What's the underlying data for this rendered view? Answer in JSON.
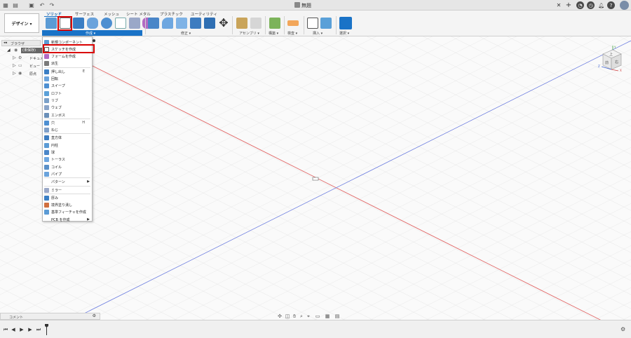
{
  "window": {
    "title": "無題"
  },
  "workspace": {
    "label": "デザイン ▾"
  },
  "tabs": [
    {
      "label": "ソリッド",
      "active": true
    },
    {
      "label": "サーフェス"
    },
    {
      "label": "メッシュ"
    },
    {
      "label": "シート メタル"
    },
    {
      "label": "プラスチック"
    },
    {
      "label": "ユーティリティ"
    }
  ],
  "tool_groups": {
    "create": "作成 ▾",
    "modify": "修正 ▾",
    "assemble": "アセンブリ ▾",
    "construct": "構築 ▾",
    "inspect": "検査 ▾",
    "insert": "挿入 ▾",
    "select": "選択 ▾"
  },
  "browser": {
    "title": "ブラウザ",
    "rows": [
      {
        "label": "(未保存)"
      },
      {
        "label": "ドキュメントの設定"
      },
      {
        "label": "ビュー"
      },
      {
        "label": "原点"
      }
    ]
  },
  "create_menu": {
    "items": [
      {
        "label": "新規コンポーネント",
        "icon": "new-component-icon",
        "key": ""
      },
      {
        "label": "スケッチを作成",
        "icon": "create-sketch-icon",
        "key": "",
        "highlighted": true
      },
      {
        "label": "フォームを作成",
        "icon": "create-form-icon",
        "key": ""
      },
      {
        "label": "派生",
        "icon": "derive-icon",
        "key": ""
      },
      {
        "label": "押し出し",
        "icon": "extrude-icon",
        "key": "E"
      },
      {
        "label": "回転",
        "icon": "revolve-icon",
        "key": ""
      },
      {
        "label": "スイープ",
        "icon": "sweep-icon",
        "key": ""
      },
      {
        "label": "ロフト",
        "icon": "loft-icon",
        "key": ""
      },
      {
        "label": "リブ",
        "icon": "rib-icon",
        "key": ""
      },
      {
        "label": "ウェブ",
        "icon": "web-icon",
        "key": ""
      },
      {
        "label": "エンボス",
        "icon": "emboss-icon",
        "key": ""
      },
      {
        "label": "穴",
        "icon": "hole-icon",
        "key": "H"
      },
      {
        "label": "ねじ",
        "icon": "thread-icon",
        "key": ""
      },
      {
        "label": "直方体",
        "icon": "box-icon",
        "key": ""
      },
      {
        "label": "円柱",
        "icon": "cylinder-icon",
        "key": ""
      },
      {
        "label": "球",
        "icon": "sphere-icon",
        "key": ""
      },
      {
        "label": "トーラス",
        "icon": "torus-icon",
        "key": ""
      },
      {
        "label": "コイル",
        "icon": "coil-icon",
        "key": ""
      },
      {
        "label": "パイプ",
        "icon": "pipe-icon",
        "key": ""
      },
      {
        "label": "パターン",
        "icon": "",
        "key": "",
        "submenu": true
      },
      {
        "label": "ミラー",
        "icon": "mirror-icon",
        "key": ""
      },
      {
        "label": "厚み",
        "icon": "thicken-icon",
        "key": ""
      },
      {
        "label": "境界塗り潰し",
        "icon": "boundary-fill-icon",
        "key": ""
      },
      {
        "label": "基準フィーチャを作成",
        "icon": "base-feature-icon",
        "key": ""
      },
      {
        "label": "PCB を作成",
        "icon": "",
        "key": "",
        "submenu": true
      }
    ]
  },
  "viewcube": {
    "front": "前",
    "top": "上",
    "right": "右",
    "x": "X",
    "y": "Y",
    "z": "Z"
  },
  "comments": {
    "label": "コメント"
  },
  "colors": {
    "accent": "#1a73c7",
    "highlight": "#d90000",
    "x_axis": "#e06060",
    "y_axis": "#7080e0"
  }
}
